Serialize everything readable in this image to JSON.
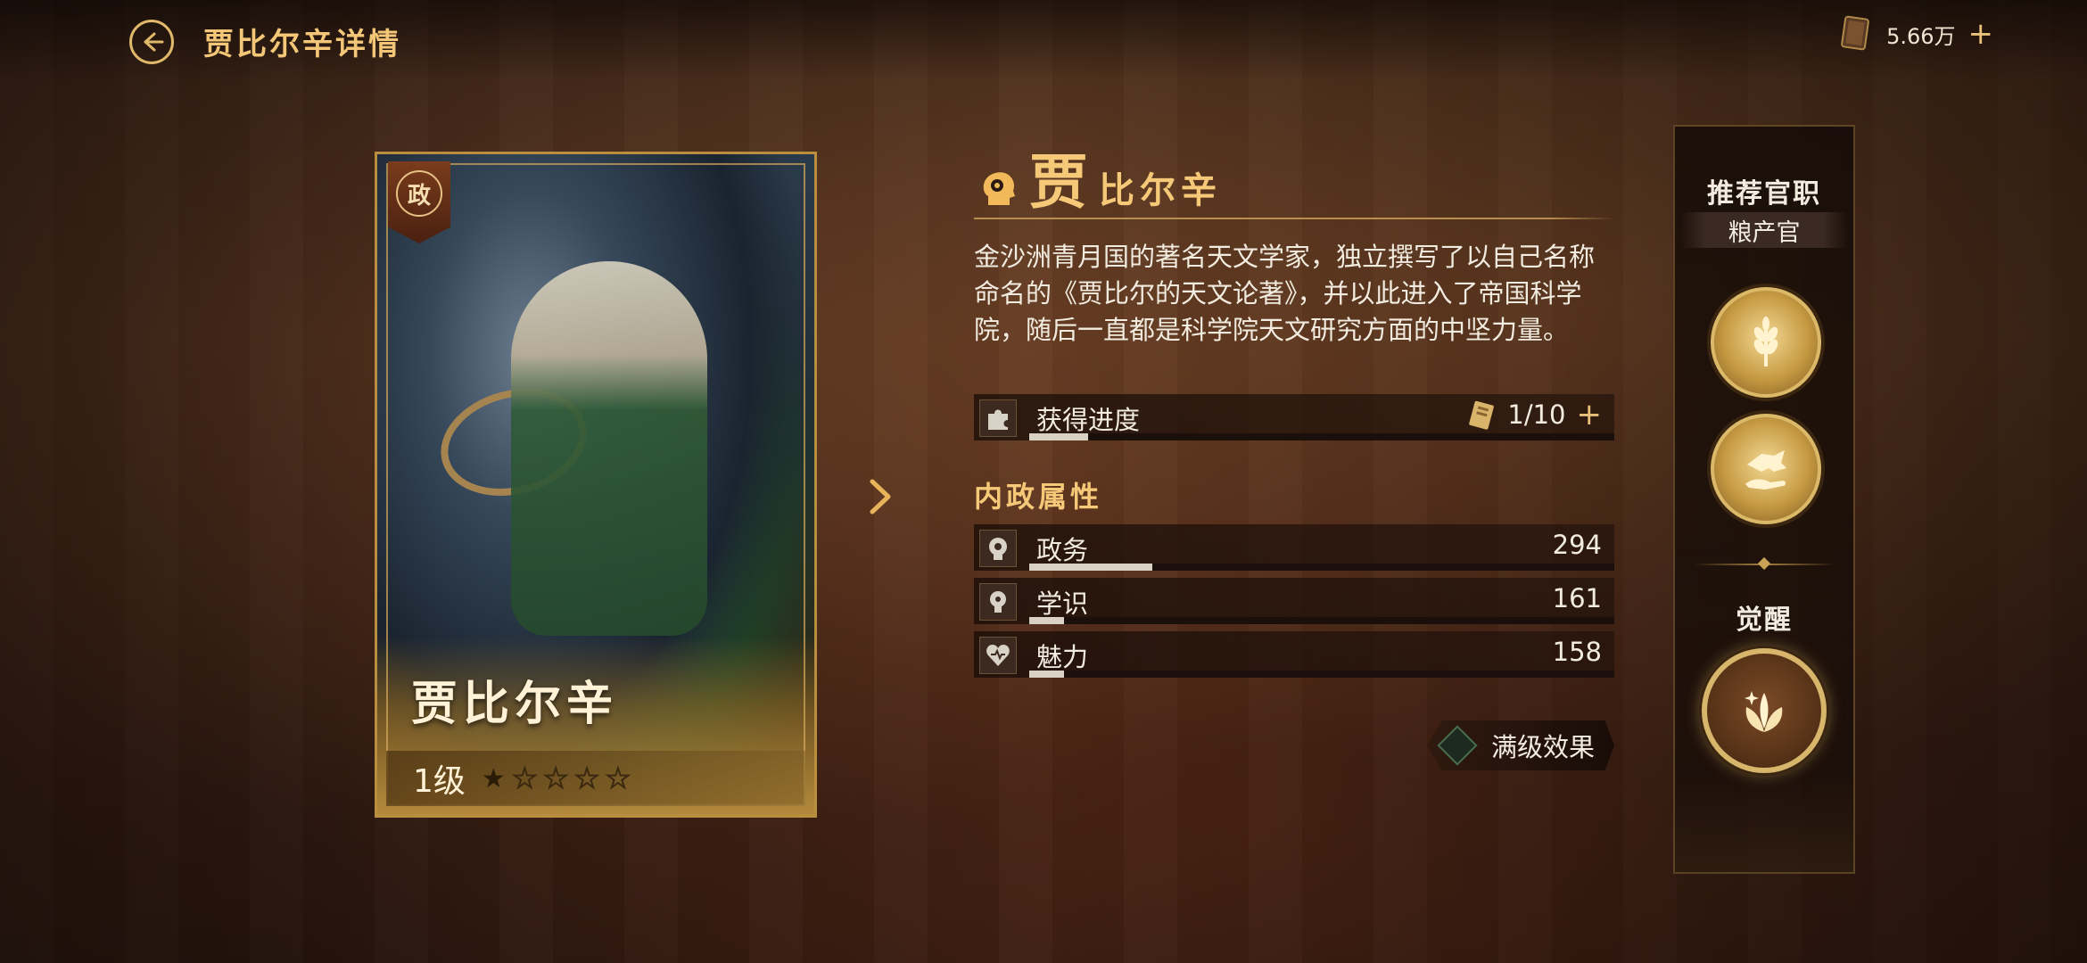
{
  "header": {
    "title": "贾比尔辛详情"
  },
  "currency": {
    "value": "5.66万",
    "plus": "+"
  },
  "card": {
    "badge": "政",
    "name": "贾比尔辛",
    "level": "1级",
    "stars_filled": 1,
    "stars_total": 5
  },
  "hero": {
    "name_first": "贾",
    "name_rest": "比尔辛",
    "description": "金沙洲青月国的著名天文学家，独立撰写了以自己名称命名的《贾比尔的天文论著》，并以此进入了帝国科学院，随后一直都是科学院天文研究方面的中坚力量。"
  },
  "progress": {
    "label": "获得进度",
    "value": "1/10",
    "plus": "+",
    "fraction": 0.1
  },
  "attributes": {
    "title": "内政属性",
    "items": [
      {
        "label": "政务",
        "value": "294",
        "fraction": 0.21
      },
      {
        "label": "学识",
        "value": "161",
        "fraction": 0.06
      },
      {
        "label": "魅力",
        "value": "158",
        "fraction": 0.06
      }
    ]
  },
  "max_effect": {
    "label": "满级效果"
  },
  "side": {
    "recommend_title": "推荐官职",
    "office": "粮产官",
    "awaken_title": "觉醒"
  },
  "colors": {
    "gold": "#f6c978",
    "panel": "#1a0f0a",
    "bar_fill": "#d9d2c4"
  }
}
